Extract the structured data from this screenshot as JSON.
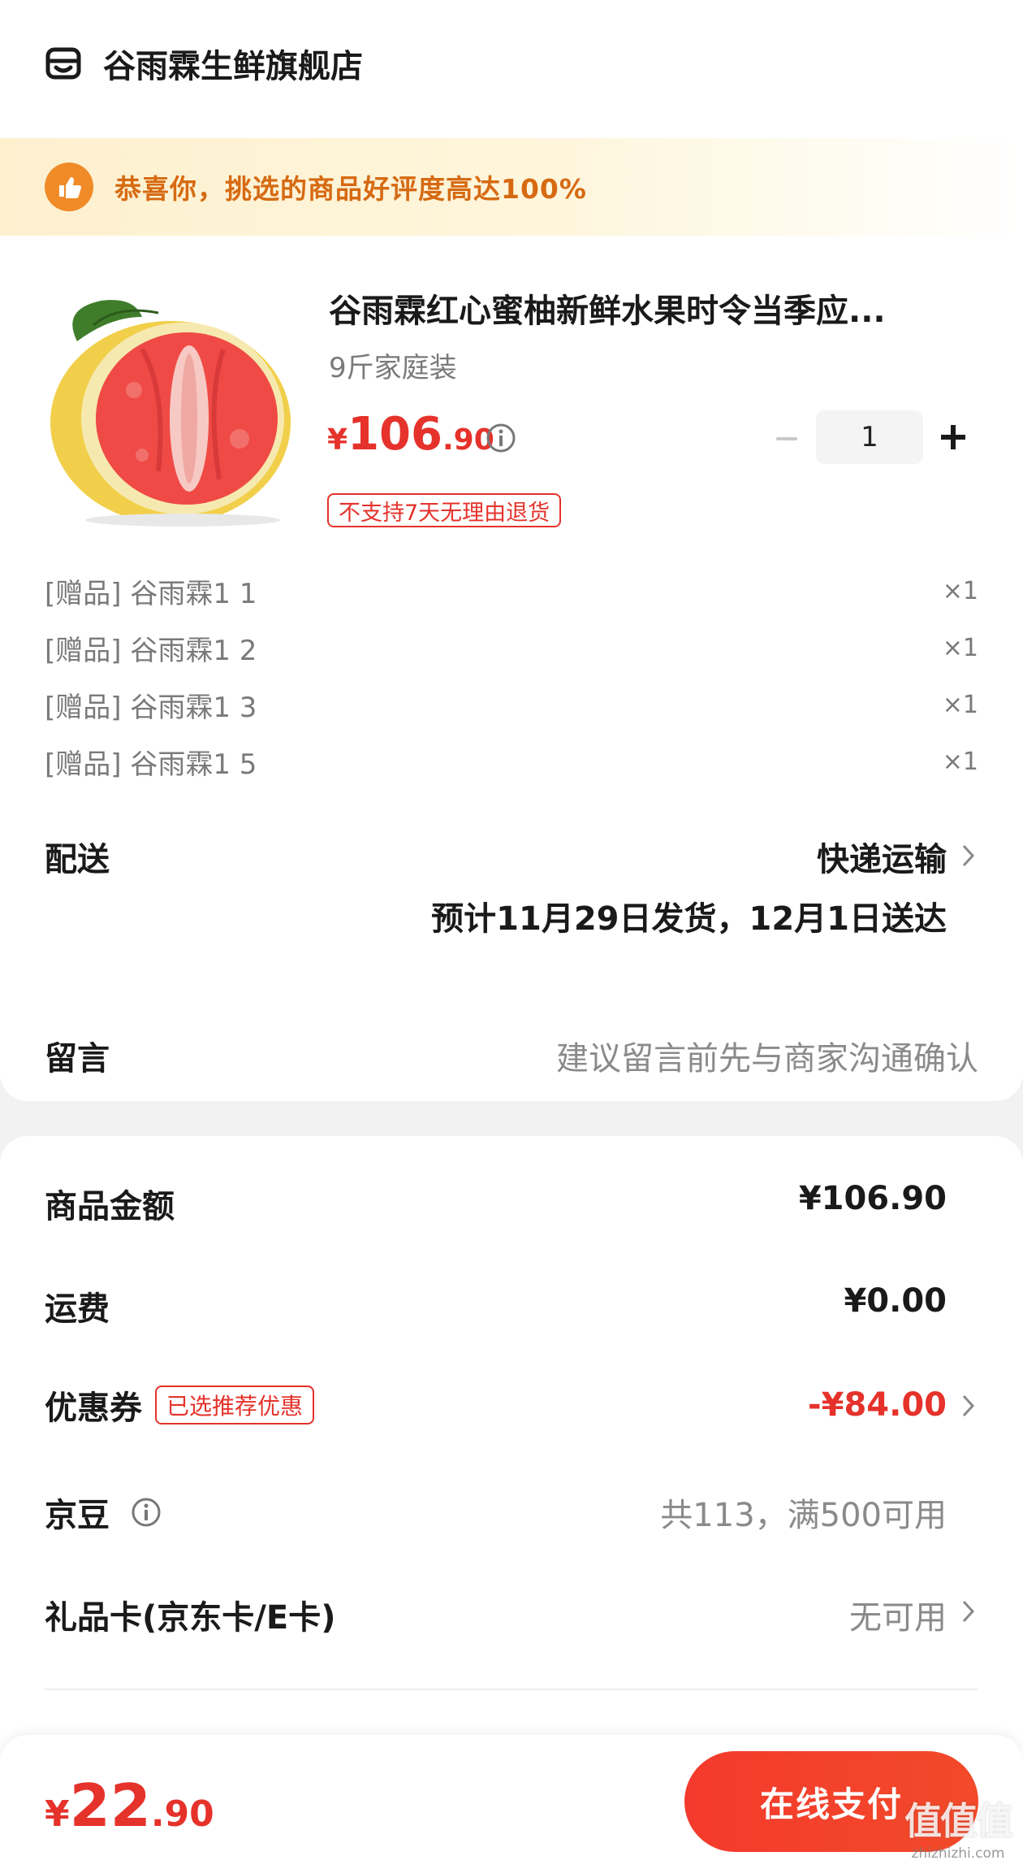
{
  "store": {
    "name": "谷雨霖生鲜旗舰店",
    "icon": "store-icon"
  },
  "banner": {
    "text": "恭喜你，挑选的商品好评度高达100%",
    "icon": "thumbs-up-icon"
  },
  "product": {
    "title": "谷雨霖红心蜜柚新鲜水果时令当季应...",
    "spec": "9斤家庭装",
    "price_yen": "¥",
    "price_int": "106",
    "price_dec": ".90",
    "quantity": "1",
    "tag": "不支持7天无理由退货"
  },
  "gifts": [
    {
      "label": "[赠品] 谷雨霖1 1",
      "qty": "×1"
    },
    {
      "label": "[赠品] 谷雨霖1 2",
      "qty": "×1"
    },
    {
      "label": "[赠品] 谷雨霖1 3",
      "qty": "×1"
    },
    {
      "label": "[赠品] 谷雨霖1 5",
      "qty": "×1"
    }
  ],
  "delivery": {
    "label": "配送",
    "method": "快递运输",
    "estimate": "预计11月29日发货，12月1日送达"
  },
  "note": {
    "label": "留言",
    "placeholder": "建议留言前先与商家沟通确认"
  },
  "summary": {
    "goods_label": "商品金额",
    "goods_value": "¥106.90",
    "shipping_label": "运费",
    "shipping_value": "¥0.00",
    "coupon_label": "优惠券",
    "coupon_tag": "已选推荐优惠",
    "coupon_value": "-¥84.00",
    "jingdou_label": "京豆",
    "jingdou_value": "共113，满500可用",
    "giftcard_label": "礼品卡(京东卡/E卡)",
    "giftcard_value": "无可用"
  },
  "footer": {
    "total_yen": "¥",
    "total_int": "22",
    "total_dec": ".90",
    "pay_label": "在线支付"
  },
  "watermark": {
    "big": "值值值",
    "small": "zhizhizhi.com"
  },
  "colors": {
    "accent_red": "#e5322b",
    "banner_orange": "#d66a12",
    "pay_button": "#f43a2c"
  }
}
